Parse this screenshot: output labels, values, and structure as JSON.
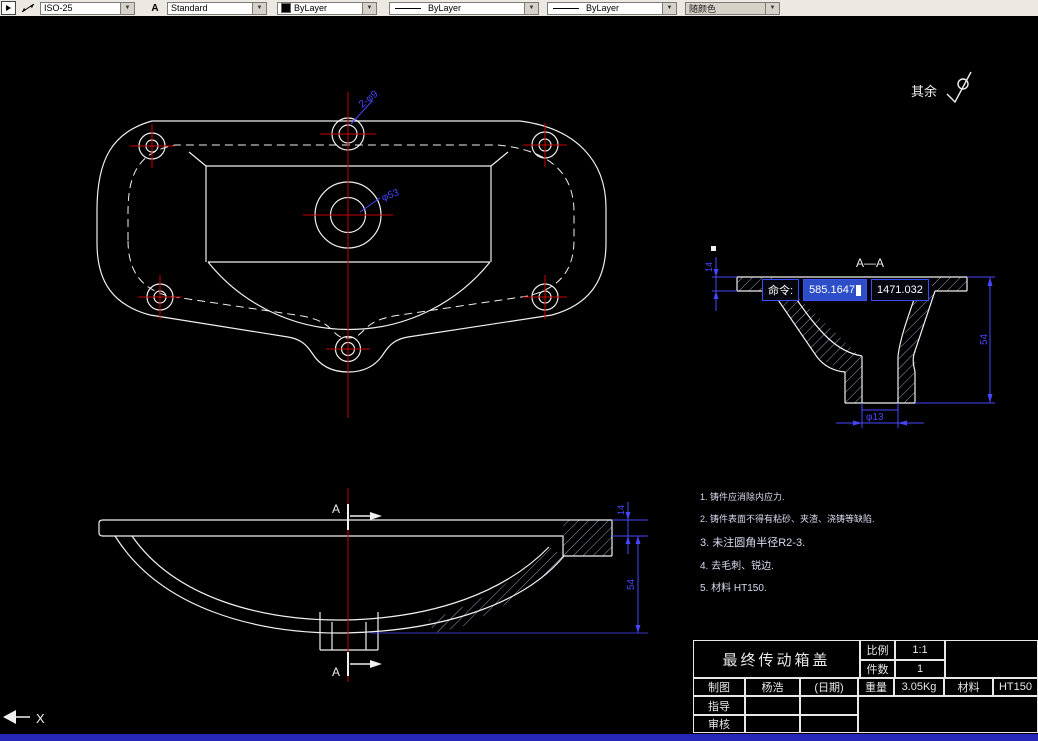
{
  "toolbar": {
    "dim_style": "ISO-25",
    "text_style": "Standard",
    "color": "ByLayer",
    "linetype": "ByLayer",
    "lineweight": "ByLayer",
    "plot_style": "随颜色",
    "dropdown_glyph": "▼",
    "text_style_icon_glyph": "A"
  },
  "drawing": {
    "surface_finish_label": "其余",
    "section_title": "A—A",
    "section_mark": "A",
    "ucs_axis": "X",
    "callouts": {
      "hole_callout": "2-φ9",
      "center_hole_dia": "φ53",
      "boss_hole_dia": "φ13",
      "aa_flange_thickness": "14",
      "aa_height": "54",
      "side_flange_thickness": "14",
      "side_depth": "54"
    },
    "notes": [
      "1. 铸件应消除内应力.",
      "2. 铸件表面不得有粘砂、夹渣、浇铸等缺陷.",
      "3. 未注圆角半径R2-3.",
      "4. 去毛刺、锐边.",
      "5. 材料 HT150."
    ],
    "dyn_input": {
      "prompt": "命令:",
      "coord_x": "585.1647",
      "coord_y": "1471.032"
    }
  },
  "title_block": {
    "part_name": "最终传动箱盖",
    "scale_label": "比例",
    "scale_value": "1:1",
    "qty_label": "件数",
    "qty_value": "1",
    "drawn_label": "制图",
    "drawn_value": "杨浩",
    "date_label": "(日期)",
    "weight_label": "重量",
    "weight_value": "3.05Kg",
    "material_label": "材料",
    "material_value": "HT150",
    "advisor_label": "指导",
    "checker_label": "审核"
  }
}
